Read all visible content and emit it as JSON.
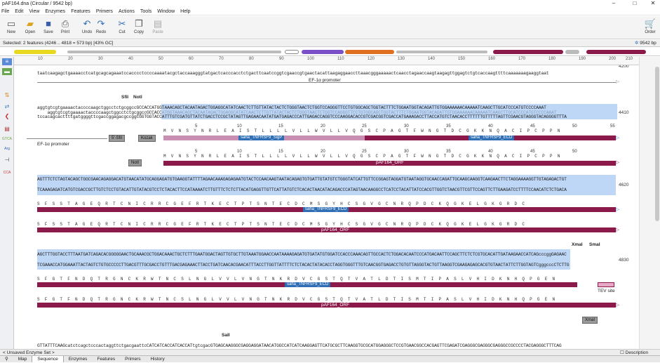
{
  "window": {
    "title": "pAF164.dna  (Circular / 9542 bp)"
  },
  "menu": [
    "File",
    "Edit",
    "View",
    "Enzymes",
    "Features",
    "Primers",
    "Actions",
    "Tools",
    "Window",
    "Help"
  ],
  "toolbar": {
    "new": "New",
    "open": "Open",
    "save": "Save",
    "print": "Print",
    "undo": "Undo",
    "redo": "Redo",
    "cut": "Cut",
    "copy": "Copy",
    "paste": "Paste",
    "order": "Order"
  },
  "status": {
    "selected": "Selected:  2 features  (4246 .. 4818 = 573 bp)      [43% GC]",
    "length": "9542 bp"
  },
  "ruler": [
    "10",
    "20",
    "30",
    "40",
    "50",
    "60",
    "70",
    "80",
    "90",
    "100",
    "110",
    "120",
    "130",
    "140",
    "150",
    "160",
    "170",
    "180",
    "190",
    "200",
    "210"
  ],
  "rows": {
    "r1": {
      "seq": "taatcaagagctgaaaacctcatgcagcagaaatccacccctccccaaaatacgctaccaaagggtatgactcacccacctctgacttcaatccggtcgaaccgtgaactacattaagaggaaccttaaacgggaaaaactcaacctagaaccaagtaagagttggagtctgtcaccaagttttcaaaaaaagaaggtaat",
      "bp": "4200",
      "feature": "EF-1α promoter"
    },
    "r2": {
      "enz1": "SfiI",
      "enz2": "NotI",
      "seq_top": "aggtgtcgtgaaaactaccccaagctggcctctgcggccGCCACCATGGTAAACAGCTACAATAGACTGGAGGCATATCAACTCTTGTTATACTACTCTGGGTAACTCTGGTCCAGGGTTCCTGTGGCAGCTGGTACTTTCTGGAATGGTACAGATTGTGGAAAAAACAAAAATCAAGCTTGCATCCCATGTCCCCAAAT",
      "seq_bot": "tccacagcacttttgatggggttcgaccggagacgccggCGGTGGTACCATTTGTCGATGTTATCTGACCTCCGCTATAGTTGAGAACAATATGATGAGACCCATTGAGACCAGGTCCCAAGGACACCGTCGACGGTCGACCATGAAAGACCTTACCATGTCTAACACCTTTTTTGTTTTTAGTTCGAACGTAGGGTACAGGGGTTTA",
      "bp": "4410",
      "aa": "M  V  N  S  Y  N  R  L  E  A  I  S  T  L  L  L  L  V  L  L  W  V  L  L  V  Q  G  S  C  P  A  G  T  F  W  N  G  T  D  C  G  K  K  N  Q  A  C  I  P  C  P  P  N",
      "sfi": "5'-SfiI",
      "kozak": "Kozak",
      "sigp": "saha_TNFRSF9_SigP",
      "ecd": "saha_TNFRSF9_ECD",
      "orf": "pAF164_ORF",
      "notbox": "NotI",
      "efp": "EF-1α promoter"
    },
    "r3": {
      "seq_top": "AGTTTCTCTAGTACAGCTGGCGAACAGAGGACATGTAACATATGCAGGAGATGTGAAGGTATTTTAGAACAAAGAGAGAATGTACTCCAACAAGTAATACAGAGTGTGATTGTATGTCTGGGTATCATTGTTCCGGAGTAGGATGTAATAGGTGCAACCAGATTGCAAGCAAGGTCAAGAACTTCTAGGAAAAGGTTGTAGAGACTGT",
      "seq_bot": "TCAAAGAGATCATGTCGACCGCTTGTCTCCTGTACATTGTATACGTCCTCTACACTTCCATAAAATCTTGTTTCTCTCTTACATGAGGTTGTTCATTATGTCTCACACTAACATACAGACCCATAGTAACAAGGCCTCATCCTACATTATCCACGTTGGTCTAACGTTCGTTCCAGTTCTTGAAGATCCTTTTCCAACATCTCTGACA",
      "bp": "4620",
      "aa": "S  F  S  S  T  A  G  E  Q  R  T  C  N  I  C  R  R  C  G  E  F  R  T  K  E  C  T  P  T  S  N  T  E  C  D  C  M  S  G  Y  H  C  S  G  V  G  C  N  R  Q  P  D  C  K  Q  G  K  E  L  G  K  G  R  D  C",
      "ecd": "saha_TNFRSF9_ECD",
      "orf": "pAF164_ORF"
    },
    "r4": {
      "enz1": "XmaI",
      "enz2": "SmaI",
      "seq_top": "AGCTTTGGTACCTTTAATGATCAGACACGGGGGAACTGCAAACGCTGGACAAACTGCTCTTTGAATGGACTAGTTGTGCTTGTAAATGGAACCAATAAAAGAGATGTGATATGTGGATCCACCCAAACAGTTGCCACTCTGGACACAATCCCATGACAATTCCAGCTTCTCTCGTGCACATTGATAAGAACCATCAGcccggGAGAAC",
      "seq_bot": "TCGAAACCATGGAAATTACTAGTCTGTGCCCCCTTGACGTTTGCGACCTGTTTGACGAGAAACTTACCTGATCAACACGAACATTTACCTTGGTTATTTTCTCTACACTATACACCTAGGTGGGTTTGTCAACGGTGAGACCTGTGTTAGGGTACTGTTAAGGTCGAAGAGAGCACGTGTAACTATTCTTGGTAGTCgggcccCTCTTG",
      "bp": "4830",
      "aa": "S  F  G  T  F  N  D  Q  T  R  G  N  C  K  R  W  T  N  C  S  L  N  G  L  V  V  L  V  N  G  T  N  K  R  D  V  C  G  S  T  Q  T  V  A  T  L  D  T  I  S  M  T  I  P  A  S  L  V  H  I  D  K  N  H  Q  P  G  E  N",
      "ecd": "saha_TNFRSF9_ECD",
      "tev": "TEV site",
      "orf": "pAF164_ORF",
      "xmabox": "XmaI"
    },
    "r5": {
      "enz": "SalI",
      "seq": "GTTATTTCAAGcatctcagctcccactaggttctgacgaattcCATCATCACCATCACCATtgtcgacGTGAGCAAGGGCGAGGAGGATAACATGGCCATCATCAAGGAGTTCATGCGCTTCAAGGTGCGCATGGAGGGCTCCGTGAACGGCCACGAGTTCGAGATCGAGGGCGAGGGCGAGGGCCGCCCCTACGAGGGCTTTCAG"
    }
  },
  "bottom": {
    "enzymeset": "< Unsaved Enzyme Set >",
    "description": "Description Panel"
  },
  "tabs": [
    "Map",
    "Sequence",
    "Enzymes",
    "Features",
    "Primers",
    "History"
  ],
  "colors": {
    "selection": "#a9c9f3",
    "orf": "#8b1a4a",
    "sigp": "#c98fb3",
    "ecd_arrow": "#c24a8b"
  }
}
